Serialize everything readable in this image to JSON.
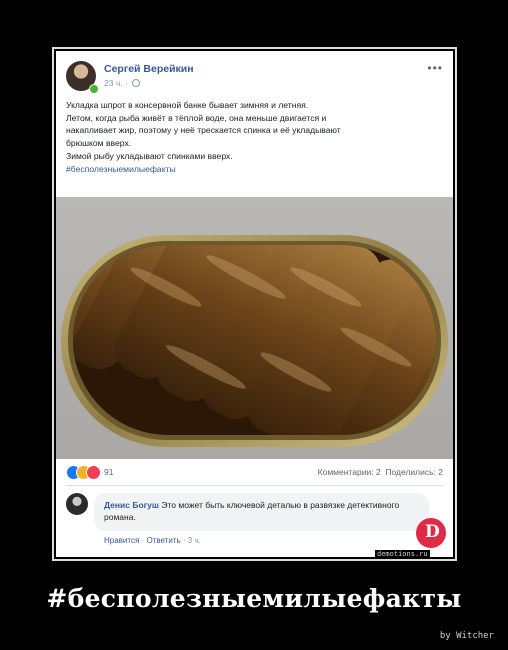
{
  "post": {
    "author": "Сергей Верейкин",
    "time": "23 ч.",
    "more_icon": "ellipsis-icon",
    "text_lines": [
      "Укладка шпрот в консервной банке бывает зимняя и летняя.",
      "Летом, когда рыба живёт в тёплой воде, она меньше двигается и",
      "накапливает жир, поэтому у неё трескается спинка и её укладывают",
      "брюшком вверх.",
      "Зимой рыбу укладывают спинками вверх."
    ],
    "hashtag": "#бесполезныемилыефакты",
    "reaction_count": "91",
    "comments_stat": "Комментарии: 2",
    "shares_stat": "Поделились: 2"
  },
  "comment": {
    "author": "Денис Богуш",
    "text": "Это может быть ключевой деталью в развязке детективного романа.",
    "like": "Нравится",
    "reply": "Ответить",
    "time": "3 ч."
  },
  "image": {
    "subject": "sprats-in-oval-tin-can"
  },
  "poster": {
    "caption": "#бесполезныемилыефакты",
    "credit": "by Witcher",
    "watermark": "demotions.ru",
    "stamp_letter": "D"
  },
  "colors": {
    "link": "#385898",
    "background": "#000000",
    "card": "#ffffff"
  }
}
